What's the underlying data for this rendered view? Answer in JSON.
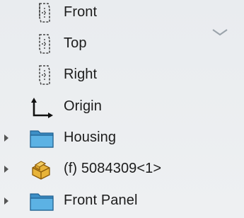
{
  "feature_tree": {
    "items": [
      {
        "label": "Front",
        "icon": "plane-icon",
        "expandable": false
      },
      {
        "label": "Top",
        "icon": "plane-icon",
        "expandable": false
      },
      {
        "label": "Right",
        "icon": "plane-icon",
        "expandable": false
      },
      {
        "label": "Origin",
        "icon": "origin-axes-icon",
        "expandable": false
      },
      {
        "label": "Housing",
        "icon": "folder-icon",
        "expandable": true
      },
      {
        "label": "(f) 5084309<1>",
        "icon": "part-icon",
        "expandable": true
      },
      {
        "label": "Front Panel",
        "icon": "folder-icon",
        "expandable": true
      }
    ],
    "collapse_control": "chevron-down-icon"
  },
  "colors": {
    "background": "#eceff1",
    "folder_blue": "#4aa3d8",
    "part_yellow": "#e8b43a",
    "text": "#1c1c1c"
  }
}
